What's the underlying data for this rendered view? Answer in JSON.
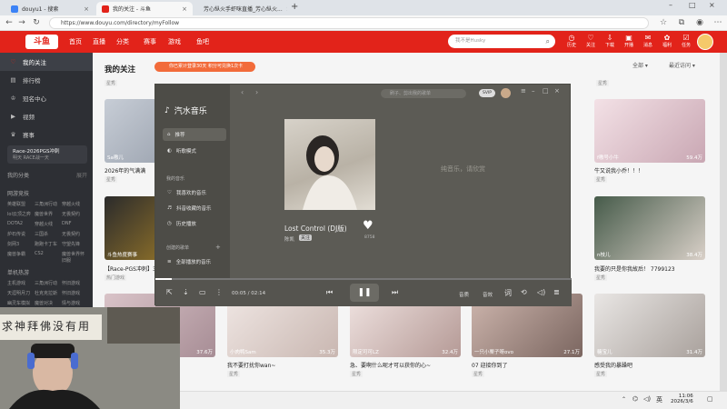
{
  "browser": {
    "tabs": [
      {
        "title": "douyu1 - 搜索",
        "fav": "#3b82f6"
      },
      {
        "title": "我的关注 - 斗鱼",
        "fav": "#e2231a",
        "active": true
      },
      {
        "title": "芳心纵火手虾咪直播_芳心纵火...",
        "fav": "#e2231a"
      }
    ],
    "new_tab": "+",
    "url": "https://www.douyu.com/directory/myFollow"
  },
  "douyu": {
    "logo": "斗鱼",
    "nav": [
      "首页",
      "直播",
      "分类",
      "赛事",
      "游戏",
      "鱼吧"
    ],
    "search_placeholder": "我不是Husky",
    "top_icons": [
      {
        "label": "历史",
        "icon": "clock-icon"
      },
      {
        "label": "关注",
        "icon": "heart-icon"
      },
      {
        "label": "下载",
        "icon": "download-icon"
      },
      {
        "label": "开播",
        "icon": "broadcast-icon"
      },
      {
        "label": "消息",
        "icon": "message-icon"
      },
      {
        "label": "福利",
        "icon": "gift-icon"
      },
      {
        "label": "任务",
        "icon": "task-icon"
      }
    ]
  },
  "sidebar": {
    "items": [
      {
        "label": "我的关注",
        "icon": "heart-icon",
        "active": true
      },
      {
        "label": "排行榜",
        "icon": "rank-icon"
      },
      {
        "label": "冠名中心",
        "icon": "crown-icon"
      },
      {
        "label": "视频",
        "icon": "video-icon"
      },
      {
        "label": "赛事",
        "icon": "trophy-icon"
      }
    ],
    "promo_title": "Race-2026PGS冲刺",
    "promo_sub": "明天 RACE战一天",
    "my_category": "我的分类",
    "my_category_action": "展开",
    "group_online": "网游竞技",
    "online_games": [
      "英雄联盟",
      "三角洲行动",
      "穿越火线",
      "lol云顶之弈",
      "魔兽世界",
      "无畏契约",
      "DOTA2",
      "穿越火线",
      "DNF",
      "炉石传说",
      "三国杀",
      "无畏契约",
      "剑网3",
      "跑跑卡丁车",
      "守望先锋",
      "魔兽争霸",
      "CS2",
      "魔兽世界怀旧服"
    ],
    "group_single": "单机热游",
    "single_games": [
      "主机游戏",
      "三角洲行动",
      "怀旧游戏",
      "天涯明月刀",
      "杜克克拉斯",
      "怀旧游戏",
      "幽灵车模拟",
      "魔兽对决",
      "情与游戏"
    ]
  },
  "main": {
    "page_title": "我的关注",
    "banner": "你已累计登录30天 积分可兑换1次卡",
    "sort_label": "最近访问",
    "filter_label": "全部",
    "section_tag": "星秀",
    "row1": [
      {
        "title": "2026年的气满满",
        "anchor": "Sa嗷儿",
        "tag": "星秀"
      },
      {
        "title": "",
        "anchor": "",
        "tag": "星秀"
      },
      {
        "title": "牛又说我小乔！！！",
        "anchor": "f嗷号小牛",
        "viewers": "59.4万",
        "tag": "星秀"
      }
    ],
    "row2": [
      {
        "title": "【Race-PGS冲刺】3月",
        "anchor": "斗鱼热度赛事",
        "tag": "热门游戏"
      },
      {
        "title": "",
        "anchor": "",
        "tag": ""
      },
      {
        "title": "我要的只是你我故后！ 7799123",
        "anchor": "n枝儿",
        "viewers": "38.4万",
        "tag": "星秀"
      }
    ],
    "row3": [
      {
        "title": "",
        "anchor": "",
        "viewers": "37.6万"
      },
      {
        "title": "我不要打扰你wan~",
        "anchor": "小肉鸭Sam",
        "viewers": "35.3万",
        "tag": "星秀"
      },
      {
        "title": "急、要啊什么呢才可以获你的心~",
        "anchor": "限定可可LZ",
        "viewers": "32.4万",
        "tag": "星秀"
      },
      {
        "title": "07 迎接你到了",
        "anchor": "一只小栗子呀ovo",
        "viewers": "27.1万",
        "tag": "星秀"
      },
      {
        "title": "感受我的暴躁吧",
        "anchor": "糖宝儿",
        "viewers": "31.4万",
        "tag": "星秀"
      }
    ]
  },
  "player": {
    "app_name": "汽水音乐",
    "nav": [
      {
        "label": "推荐",
        "icon": "home-icon",
        "active": true
      },
      {
        "label": "听歌模式",
        "icon": "headphones-icon"
      }
    ],
    "my_music_label": "我的音乐",
    "my_music": [
      {
        "label": "我喜欢的音乐",
        "icon": "heart-icon"
      },
      {
        "label": "抖音收藏的音乐",
        "icon": "tiktok-icon"
      },
      {
        "label": "历史播放",
        "icon": "clock-icon"
      }
    ],
    "created_label": "创建的歌单",
    "created_add": "+",
    "created": [
      {
        "label": "全部播放的音乐",
        "icon": "list-icon"
      }
    ],
    "search_placeholder": "刷子、剪出我的歌单",
    "vip_label": "SVIP",
    "song_title": "Lost Control (DJ版)",
    "artist": "陈凯",
    "follow_label": "关注",
    "like_count": "8758",
    "lyric_hint": "纯音乐，请欣赏",
    "time_current": "00:05",
    "time_total": "02:14",
    "progress": 0.04,
    "right_controls": [
      "音质",
      "音效"
    ]
  },
  "taskbar": {
    "time": "11:06",
    "date": "2026/3/6",
    "ime": "英"
  },
  "webcam": {
    "calligraphy": "求神拜佛没有用"
  },
  "colors": {
    "douyu_red": "#e2231a",
    "player_bg": "#5c5b55"
  }
}
